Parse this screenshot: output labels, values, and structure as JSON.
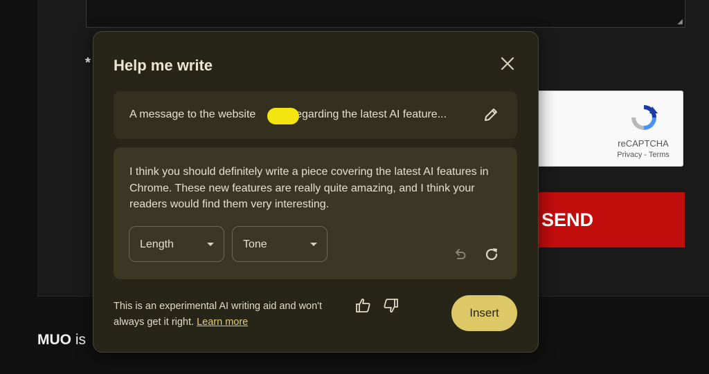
{
  "page": {
    "required_marker": "*",
    "recaptcha": {
      "label": "reCAPTCHA",
      "privacy": "Privacy",
      "separator": " - ",
      "terms": "Terms"
    },
    "send_label": "SEND",
    "footer_brand": "MUO",
    "footer_text": " is"
  },
  "dialog": {
    "title": "Help me write",
    "prompt": {
      "text_before": "A message to the website ",
      "text_after": "regarding the latest AI feature..."
    },
    "result_text": "I think you should definitely write a piece covering the latest AI features in Chrome. These new features are really quite amazing, and I think your readers would find them very interesting.",
    "length_label": "Length",
    "tone_label": "Tone",
    "disclaimer": "This is an experimental AI writing aid and won't always get it right. ",
    "learn_more": "Learn more",
    "insert_label": "Insert"
  },
  "colors": {
    "dialog_bg": "#272418",
    "card_bg": "#34301f",
    "accent": "#dcc867",
    "send_red": "#c20d0d",
    "redaction": "#f4e40f"
  },
  "icons": [
    "close-icon",
    "pencil-icon",
    "undo-icon",
    "retry-icon",
    "thumbs-up-icon",
    "thumbs-down-icon",
    "recaptcha-logo-icon",
    "resize-grip-icon"
  ]
}
